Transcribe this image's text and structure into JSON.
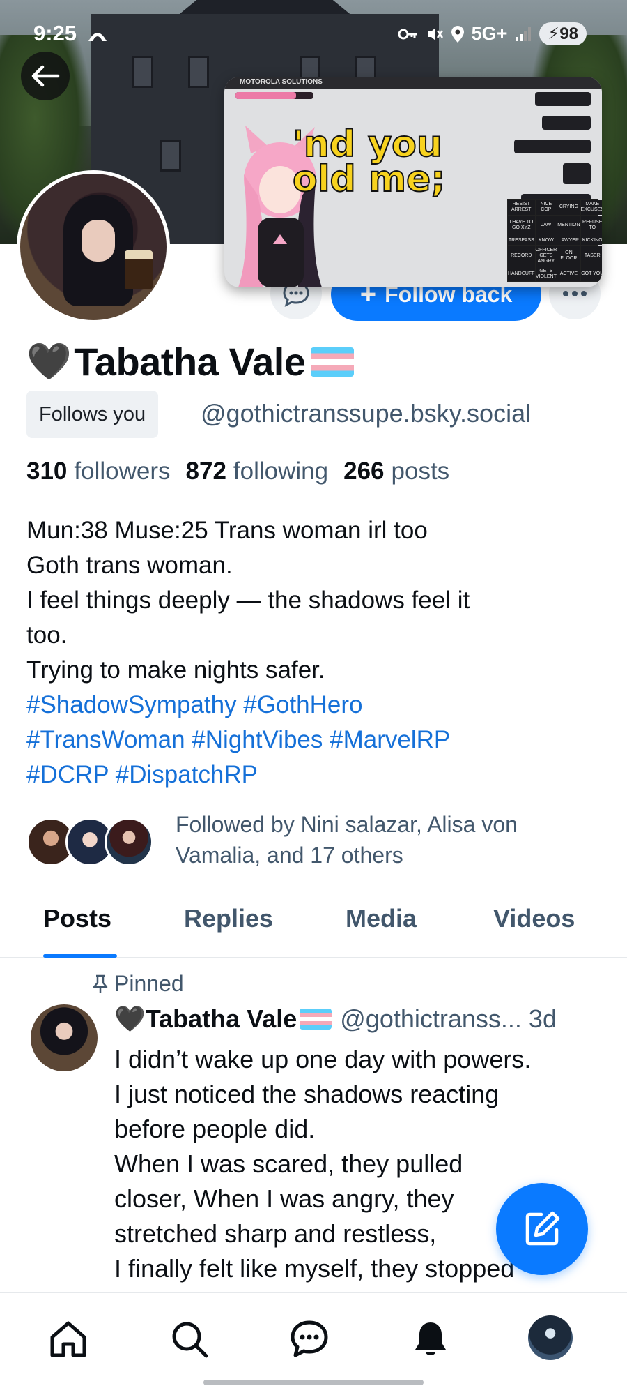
{
  "status_bar": {
    "time": "9:25",
    "network": "5G+",
    "battery": "98"
  },
  "pip_video": {
    "watermark": "MOTOROLA SOLUTIONS",
    "caption": "'nd you\nold me;",
    "bingo_cells": [
      "RESIST ARREST",
      "NICE COP",
      "CRYING",
      "MAKE EXCUSES",
      "FREE",
      "I HAVE TO GO XYZ",
      "JAW",
      "MENTION",
      "REFUSE TO",
      "DON'T TOUCH ME",
      "TRESPASS",
      "KNOW",
      "LAWYER",
      "KICKING",
      "SITTING",
      "RECORD",
      "OFFICER GETS ANGRY",
      "ON FLOOR",
      "TASER",
      "DUI",
      "HANDCUFF",
      "GETS VIOLENT",
      "ACTIVE",
      "GOT YOU",
      "ARREST"
    ]
  },
  "actions": {
    "follow_back_label": "Follow back"
  },
  "profile": {
    "heart": "🖤",
    "display_name": "Tabatha Vale",
    "follows_you": "Follows you",
    "handle": "@gothictranssupe.bsky.social",
    "followers_count": "310",
    "followers_label": "followers",
    "following_count": "872",
    "following_label": "following",
    "posts_count": "266",
    "posts_label": "posts",
    "bio_lines": [
      "Mun:38 Muse:25 Trans woman irl too",
      "Goth trans woman.",
      "I feel things deeply — the shadows feel it",
      "too.",
      "Trying to make nights safer."
    ],
    "hashtag_lines": [
      "#ShadowSympathy #GothHero",
      "#TransWoman #NightVibes #MarvelRP",
      "#DCRP #DispatchRP"
    ],
    "followed_by": "Followed by Nini salazar, Alisa von Vamalia, and 17 others"
  },
  "tabs": [
    {
      "label": "Posts",
      "active": true
    },
    {
      "label": "Replies",
      "active": false
    },
    {
      "label": "Media",
      "active": false
    },
    {
      "label": "Videos",
      "active": false
    }
  ],
  "pinned_post": {
    "pinned_label": "Pinned",
    "heart": "🖤",
    "author": "Tabatha Vale",
    "handle": "@gothictranss...",
    "time": "3d",
    "lines": [
      "I didn’t wake up one day with powers.",
      "I just noticed the shadows reacting",
      "before people did.",
      "When I was scared, they pulled",
      "closer, When I was angry, they",
      "stretched sharp and restless,",
      "I finally felt like myself, they stopped"
    ]
  },
  "icons": {
    "back": "arrow-left-icon",
    "chat": "chat-icon",
    "more": "more-icon",
    "pin": "pin-icon",
    "compose": "compose-icon",
    "home": "home-icon",
    "search": "search-icon",
    "messages": "messages-icon",
    "notifications": "bell-icon"
  },
  "colors": {
    "accent": "#0a7aff",
    "hashtag": "#1570d8",
    "muted": "#42576c"
  }
}
